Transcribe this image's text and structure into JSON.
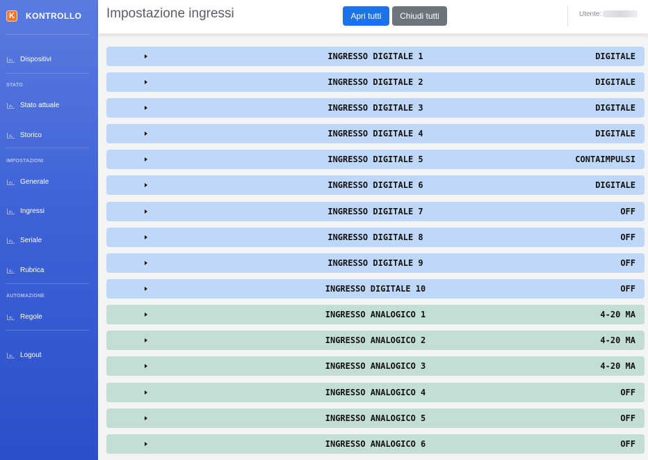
{
  "app": {
    "logo_letter": "K",
    "name": "KONTROLLO"
  },
  "sidebar": {
    "items": [
      {
        "label": "Dispositivi"
      },
      {
        "section": "STATO"
      },
      {
        "label": "Stato attuale"
      },
      {
        "label": "Storico"
      },
      {
        "section": "IMPOSTAZIONI"
      },
      {
        "label": "Generale"
      },
      {
        "label": "Ingressi"
      },
      {
        "label": "Seriale"
      },
      {
        "label": "Rubrica"
      },
      {
        "section": "AUTOMAZIONE"
      },
      {
        "label": "Regole"
      },
      {
        "label": "Logout"
      }
    ]
  },
  "header": {
    "title": "Impostazione ingressi",
    "open_all": "Apri tutti",
    "close_all": "Chiudi tutti",
    "user_label": "Utente:"
  },
  "inputs": [
    {
      "name": "INGRESSO DIGITALE 1",
      "mode": "DIGITALE",
      "kind": "digital"
    },
    {
      "name": "INGRESSO DIGITALE 2",
      "mode": "DIGITALE",
      "kind": "digital"
    },
    {
      "name": "INGRESSO DIGITALE 3",
      "mode": "DIGITALE",
      "kind": "digital"
    },
    {
      "name": "INGRESSO DIGITALE 4",
      "mode": "DIGITALE",
      "kind": "digital"
    },
    {
      "name": "INGRESSO DIGITALE 5",
      "mode": "CONTAIMPULSI",
      "kind": "digital"
    },
    {
      "name": "INGRESSO DIGITALE 6",
      "mode": "DIGITALE",
      "kind": "digital"
    },
    {
      "name": "INGRESSO DIGITALE 7",
      "mode": "OFF",
      "kind": "digital"
    },
    {
      "name": "INGRESSO DIGITALE 8",
      "mode": "OFF",
      "kind": "digital"
    },
    {
      "name": "INGRESSO DIGITALE 9",
      "mode": "OFF",
      "kind": "digital"
    },
    {
      "name": "INGRESSO DIGITALE 10",
      "mode": "OFF",
      "kind": "digital"
    },
    {
      "name": "INGRESSO ANALOGICO 1",
      "mode": "4-20 MA",
      "kind": "analog"
    },
    {
      "name": "INGRESSO ANALOGICO 2",
      "mode": "4-20 MA",
      "kind": "analog"
    },
    {
      "name": "INGRESSO ANALOGICO 3",
      "mode": "4-20 MA",
      "kind": "analog"
    },
    {
      "name": "INGRESSO ANALOGICO 4",
      "mode": "OFF",
      "kind": "analog"
    },
    {
      "name": "INGRESSO ANALOGICO 5",
      "mode": "OFF",
      "kind": "analog"
    },
    {
      "name": "INGRESSO ANALOGICO 6",
      "mode": "OFF",
      "kind": "analog"
    }
  ],
  "colors": {
    "sidebar_top": "#5a7be0",
    "sidebar_bottom": "#2b4fc9",
    "logo": "#f5792a",
    "primary": "#1b72ea",
    "secondary": "#6c757d",
    "digital_row": "#bfd7f9",
    "analog_row": "#c3dfd3"
  }
}
